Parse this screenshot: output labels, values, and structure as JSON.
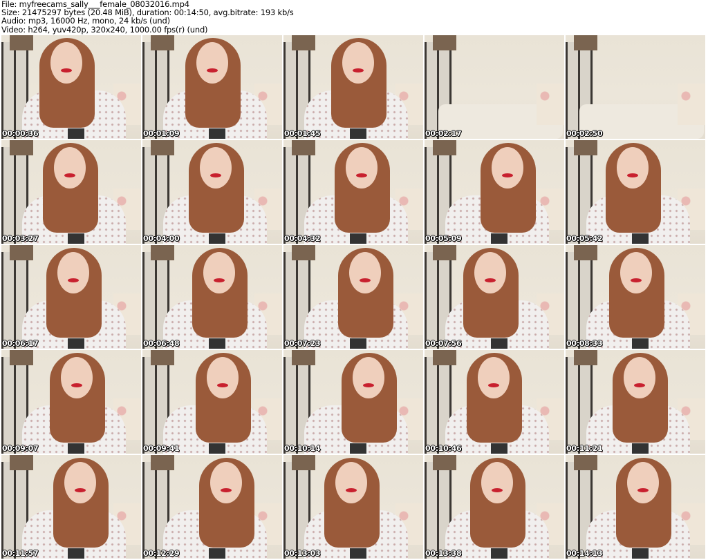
{
  "info": {
    "file": "File: myfreecams_sally___female_08032016.mp4",
    "size": "Size: 21475297 bytes (20.48 MiB), duration: 00:14:50, avg.bitrate: 193 kb/s",
    "audio": "Audio: mp3, 16000 Hz, mono, 24 kb/s (und)",
    "video": "Video: h264, yuv420p, 320x240, 1000.00 fps(r) (und)"
  },
  "thumbnails": [
    {
      "time": "00:00:36",
      "empty": false
    },
    {
      "time": "00:01:09",
      "empty": false
    },
    {
      "time": "00:01:45",
      "empty": false
    },
    {
      "time": "00:02:17",
      "empty": true
    },
    {
      "time": "00:02:50",
      "empty": true
    },
    {
      "time": "00:03:27",
      "empty": false
    },
    {
      "time": "00:04:00",
      "empty": false
    },
    {
      "time": "00:04:32",
      "empty": false
    },
    {
      "time": "00:05:09",
      "empty": false
    },
    {
      "time": "00:05:42",
      "empty": false
    },
    {
      "time": "00:06:17",
      "empty": false
    },
    {
      "time": "00:06:48",
      "empty": false
    },
    {
      "time": "00:07:23",
      "empty": false
    },
    {
      "time": "00:07:56",
      "empty": false
    },
    {
      "time": "00:08:33",
      "empty": false
    },
    {
      "time": "00:09:07",
      "empty": false
    },
    {
      "time": "00:09:41",
      "empty": false
    },
    {
      "time": "00:10:14",
      "empty": false
    },
    {
      "time": "00:10:46",
      "empty": false
    },
    {
      "time": "00:11:21",
      "empty": false
    },
    {
      "time": "00:11:57",
      "empty": false
    },
    {
      "time": "00:12:29",
      "empty": false
    },
    {
      "time": "00:13:03",
      "empty": false
    },
    {
      "time": "00:13:38",
      "empty": false
    },
    {
      "time": "00:14:13",
      "empty": false
    }
  ]
}
